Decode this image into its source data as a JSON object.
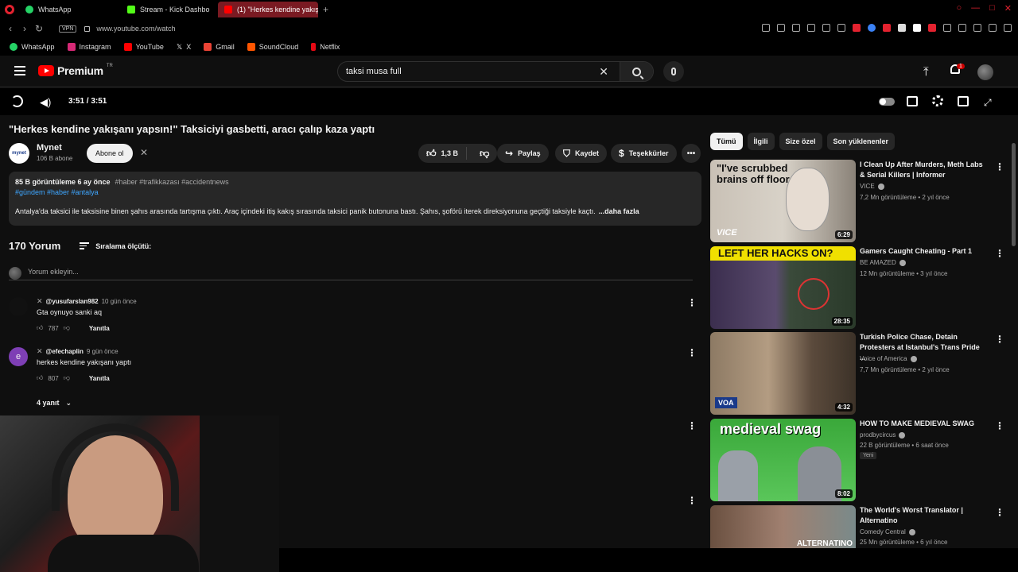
{
  "browser": {
    "tabs": [
      {
        "label": "WhatsApp",
        "color": "#25d366",
        "active": false
      },
      {
        "label": "Stream - Kick Dashbo",
        "color": "#53fc18",
        "active": false
      },
      {
        "label": "(1) \"Herkes kendine yakışa",
        "color": "#ff0000",
        "active": true
      }
    ],
    "new_tab": "+",
    "vpn": "VPN",
    "url": "www.youtube.com/watch",
    "bookmarks": [
      {
        "label": "WhatsApp",
        "color": "#25d366"
      },
      {
        "label": "Instagram",
        "color": "#d62976"
      },
      {
        "label": "YouTube",
        "color": "#ff0000"
      },
      {
        "label": "X",
        "color": "#ffffff"
      },
      {
        "label": "Gmail",
        "color": "#ea4335"
      },
      {
        "label": "SoundCloud",
        "color": "#ff5500"
      },
      {
        "label": "Netflix",
        "color": "#e50914"
      }
    ]
  },
  "masthead": {
    "logo": "Premium",
    "region": "TR",
    "search_query": "taksi musa full",
    "notif_count": "1"
  },
  "player": {
    "time": "3:51 / 3:51"
  },
  "video": {
    "title": "\"Herkes kendine yakışanı yapsın!\" Taksiciyi gasbetti, aracı çalıp kaza yaptı",
    "channel": "Mynet",
    "channel_avatar_text": "mynet",
    "subs": "106 B abone",
    "subscribe": "Abone ol",
    "likes": "1,3 B",
    "share": "Paylaş",
    "save": "Kaydet",
    "thanks": "Teşekkürler",
    "views_date": "85 B görüntüleme  6 ay önce",
    "tags": "#haber #trafikkazası #accidentnews",
    "hashtags": "#gündem #haber #antalya",
    "description": "Antalya'da taksici ile taksisine binen şahıs arasında tartışma çıktı. Araç içindeki itiş kakış sırasında taksici panik butonuna bastı. Şahıs, şoförü iterek direksiyonuna geçtiği taksiyle kaçtı.",
    "more": "...daha fazla"
  },
  "comments": {
    "count": "170 Yorum",
    "sort": "Sıralama ölçütü:",
    "placeholder": "Yorum ekleyin...",
    "items": [
      {
        "user": "@yusufarslan982",
        "ago": "10 gün önce",
        "text": "Gta oynuyo sanki aq",
        "likes": "787",
        "reply": "Yanıtla"
      },
      {
        "user": "@efechaplin",
        "ago": "9 gün önce",
        "text": "herkes kendine yakışanı yaptı",
        "likes": "807",
        "reply": "Yanıtla",
        "avatar_letter": "e"
      }
    ],
    "replies_toggle": "4 yanıt"
  },
  "sidebar": {
    "chips": [
      "Tümü",
      "İlgili",
      "Size özel",
      "Son yüklenenler"
    ],
    "items": [
      {
        "title": "I Clean Up After Murders, Meth Labs & Serial Killers | Informer",
        "channel": "VICE",
        "meta": "7,2 Mn görüntüleme • 2 yıl önce",
        "duration": "6:29",
        "thumb_text": "\"I've scrubbed brains off floors.\"",
        "badge": "VICE"
      },
      {
        "title": "Gamers Caught Cheating - Part 1",
        "channel": "BE AMAZED",
        "meta": "12 Mn görüntüleme • 3 yıl önce",
        "duration": "28:35",
        "thumb_text": "LEFT HER HACKS ON?"
      },
      {
        "title": "Turkish Police Chase, Detain Protesters at Istanbul's Trans Pride ...",
        "channel": "Voice of America",
        "meta": "7,7 Mn görüntüleme • 2 yıl önce",
        "duration": "4:32",
        "badge": "VOA"
      },
      {
        "title": "HOW TO MAKE MEDIEVAL SWAG",
        "channel": "prodbycircus",
        "meta": "22 B görüntüleme • 6 saat önce",
        "duration": "8:02",
        "thumb_text": "medieval swag",
        "new": "Yeni"
      },
      {
        "title": "The World's Worst Translator | Alternatino",
        "channel": "Comedy Central",
        "meta": "25 Mn görüntüleme • 6 yıl önce",
        "thumb_text": "ALTERNATINO"
      }
    ]
  }
}
